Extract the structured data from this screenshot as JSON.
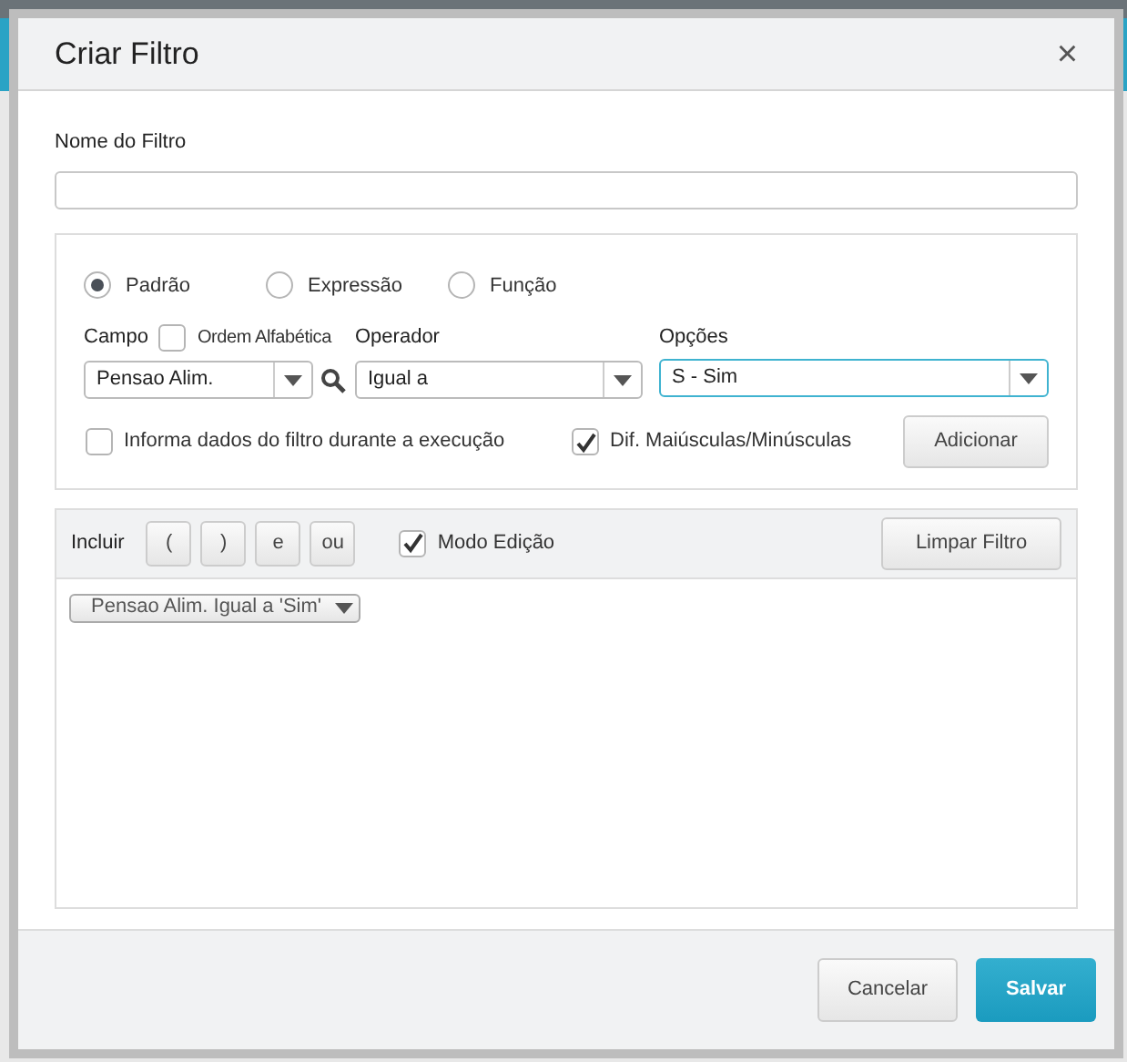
{
  "dialog": {
    "title": "Criar Filtro",
    "close": "×"
  },
  "name_field": {
    "label": "Nome do Filtro"
  },
  "modes": [
    {
      "label": "Padrão",
      "selected": true
    },
    {
      "label": "Expressão",
      "selected": false
    },
    {
      "label": "Função",
      "selected": false
    }
  ],
  "campo": {
    "label": "Campo",
    "alpha_label": "Ordem Alfabética",
    "alpha_checked": false,
    "value": "Pensao Alim."
  },
  "operador": {
    "label": "Operador",
    "value": "Igual a"
  },
  "opcoes": {
    "label": "Opções",
    "value": "S - Sim"
  },
  "informa": {
    "label": "Informa dados do filtro durante a execução",
    "checked": false
  },
  "case_sensitive": {
    "label": "Dif. Maiúsculas/Minúsculas",
    "checked": true
  },
  "add_button": "Adicionar",
  "toolbar": {
    "label": "Incluir",
    "buttons": [
      "(",
      ")",
      "e",
      "ou"
    ],
    "edit_mode": {
      "label": "Modo Edição",
      "checked": true
    },
    "clear_button": "Limpar Filtro"
  },
  "filters": [
    "Pensao Alim. Igual a 'Sim'"
  ],
  "footer": {
    "cancel": "Cancelar",
    "save": "Salvar"
  }
}
